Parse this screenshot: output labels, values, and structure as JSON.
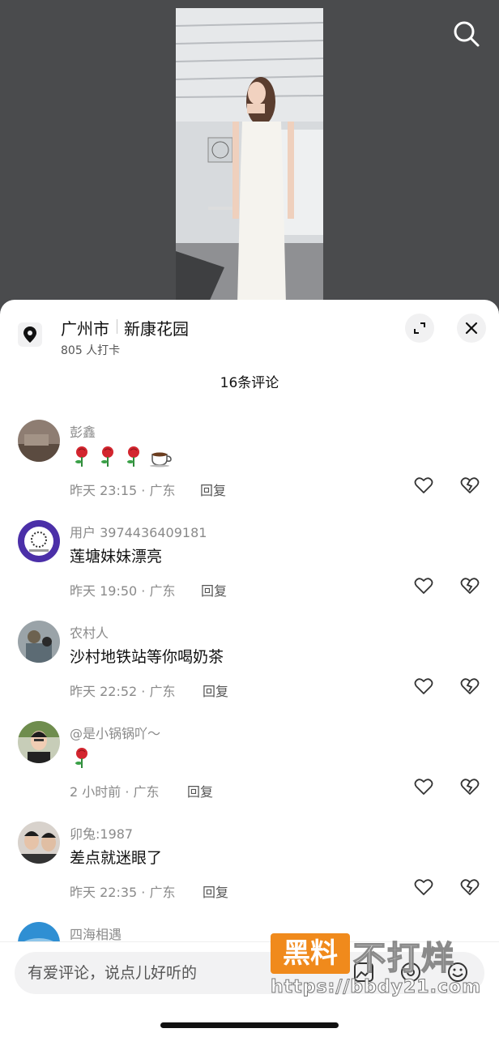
{
  "location": {
    "city": "广州市",
    "place": "新康花园",
    "checkins": "805 人打卡"
  },
  "comments_header": "16条评论",
  "comments": [
    {
      "user": "彭鑫",
      "text": "",
      "emojis": [
        "rose",
        "rose",
        "rose",
        "coffee"
      ],
      "meta": "昨天 23:15 · 广东",
      "reply": "回复"
    },
    {
      "user": "用户 3974436409181",
      "text": "莲塘妹妹漂亮",
      "meta": "昨天 19:50 · 广东",
      "reply": "回复"
    },
    {
      "user": "农村人",
      "text": "沙村地铁站等你喝奶茶",
      "meta": "昨天 22:52 · 广东",
      "reply": "回复"
    },
    {
      "user": "@是小锅锅吖～",
      "text": "",
      "emojis": [
        "rose"
      ],
      "meta": "2 小时前 · 广东",
      "reply": "回复"
    },
    {
      "user": "卯兔:1987",
      "text": "差点就迷眼了",
      "meta": "昨天 22:35 · 广东",
      "reply": "回复"
    },
    {
      "user": "四海相遇",
      "text": "",
      "meta": "",
      "reply": ""
    }
  ],
  "input": {
    "placeholder": "有爱评论，说点儿好听的"
  },
  "watermark": {
    "box": "黑料",
    "text": "不打烊",
    "url": "https://bbdy21.com"
  },
  "icons": {
    "search": "search-icon",
    "pin": "location-pin-icon",
    "expand": "expand-icon",
    "close": "close-icon",
    "like": "heart-icon",
    "dislike": "broken-heart-icon",
    "image": "image-icon",
    "mention": "at-icon",
    "emoji": "emoji-icon"
  },
  "colors": {
    "background": "#4a4b4d",
    "sheet": "#ffffff",
    "muted_text": "#8a8a8a",
    "watermark_orange": "#f08a1c"
  }
}
